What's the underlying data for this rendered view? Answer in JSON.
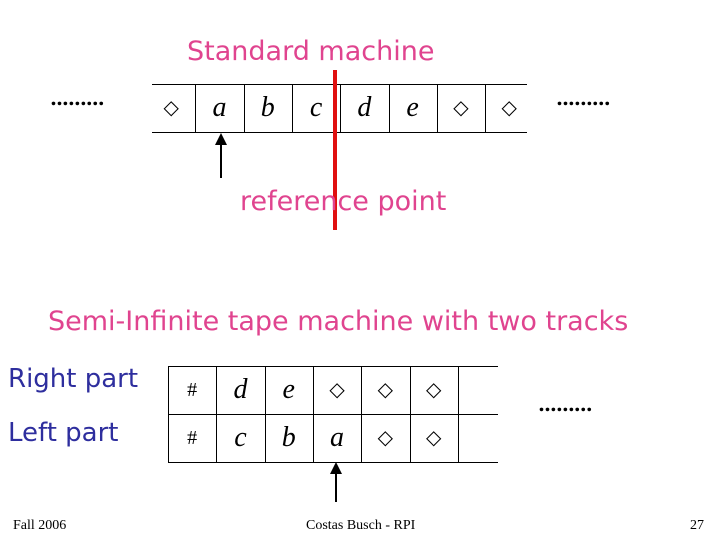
{
  "slide": {
    "top_title": "Standard machine",
    "reference_label": "reference point",
    "bottom_title": "Semi-Infinite tape machine with two tracks",
    "ellipsis": ".........",
    "track_labels": [
      "Right part",
      "Left part"
    ],
    "standard_tape": [
      "◇",
      "a",
      "b",
      "c",
      "d",
      "e",
      "◇",
      "◇"
    ],
    "right_track": [
      "#",
      "d",
      "e",
      "◇",
      "◇",
      "◇",
      ""
    ],
    "left_track": [
      "#",
      "c",
      "b",
      "a",
      "◇",
      "◇",
      ""
    ],
    "footer": {
      "left": "Fall 2006",
      "center": "Costas Busch - RPI",
      "right": "27"
    },
    "colors": {
      "title": "#e0448f",
      "labels": "#2e2e9e",
      "reference_line": "#e01010"
    }
  }
}
